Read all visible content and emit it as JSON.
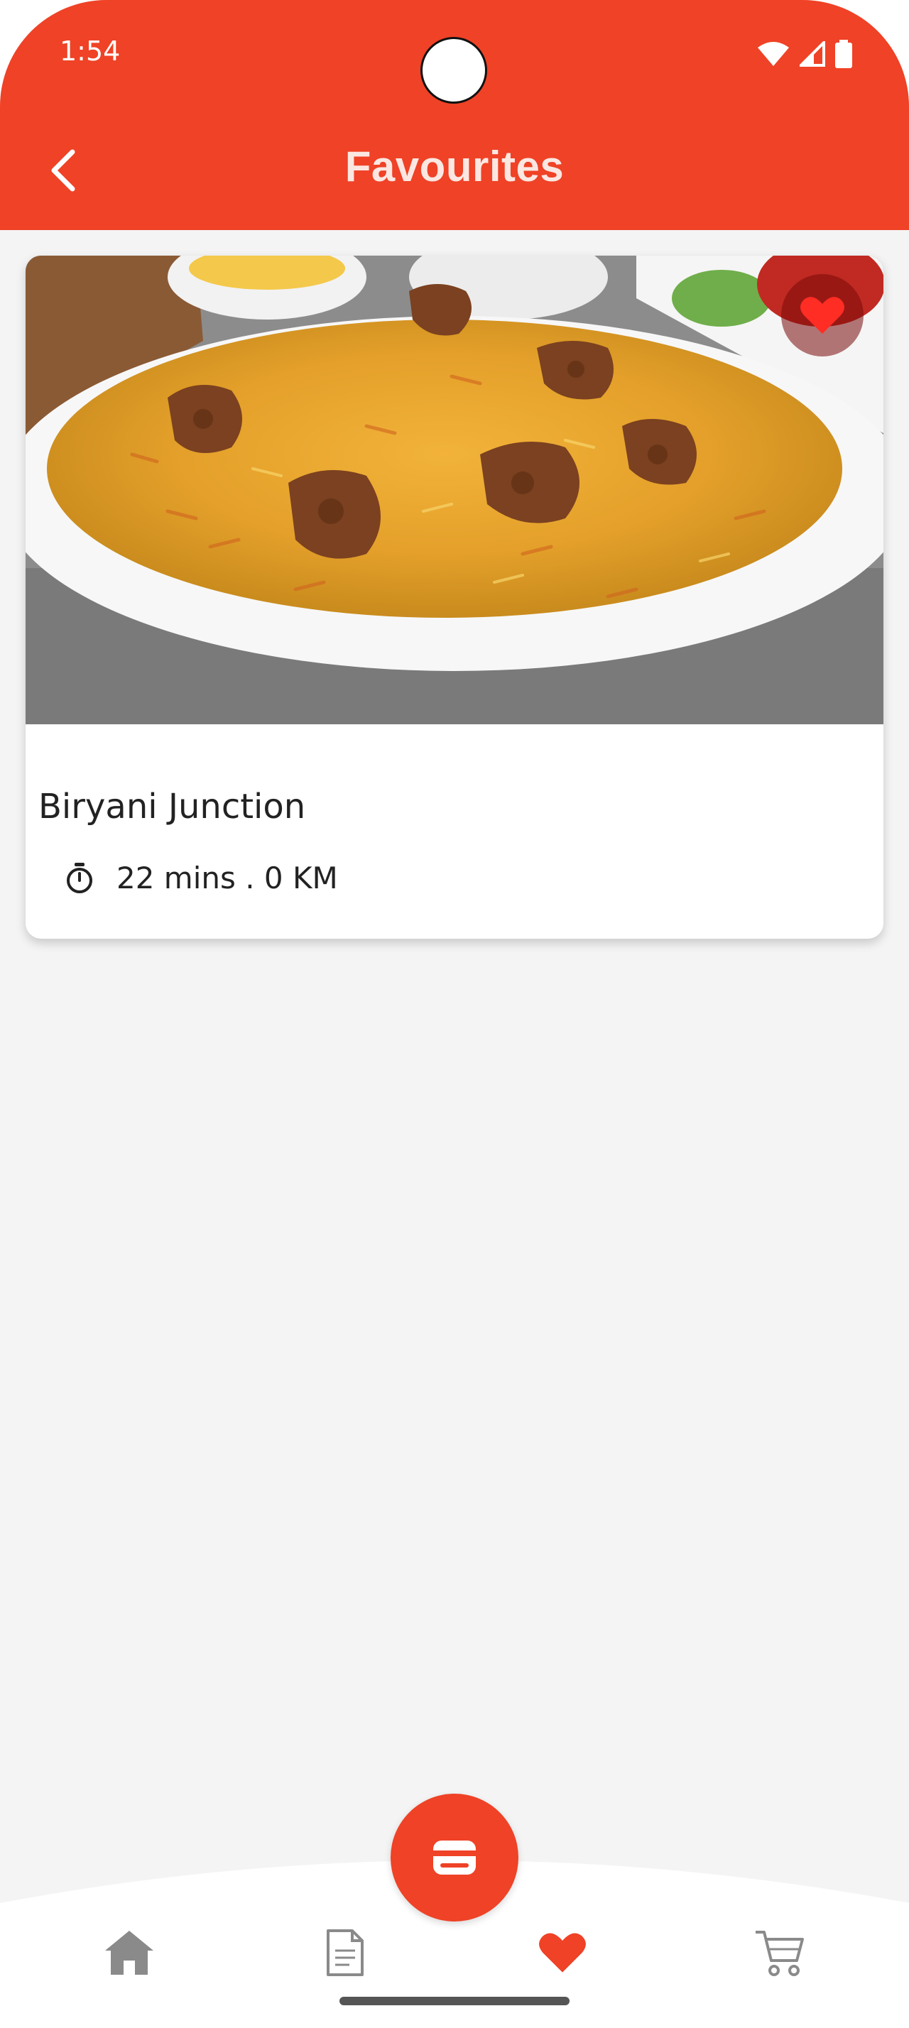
{
  "status_bar": {
    "time": "1:54",
    "icons": [
      "wifi-icon",
      "cell-signal-icon",
      "battery-icon"
    ]
  },
  "header": {
    "title": "Favourites",
    "back_icon": "chevron-left-icon"
  },
  "favourites": [
    {
      "name": "Biryani Junction",
      "meta": "22 mins . 0 KM",
      "image": "biryani-plate",
      "is_favourite": true
    }
  ],
  "bottom_nav": {
    "items": [
      {
        "icon": "home-icon",
        "active": false
      },
      {
        "icon": "orders-document-icon",
        "active": false
      },
      {
        "icon": "heart-icon",
        "active": true
      },
      {
        "icon": "cart-icon",
        "active": false
      }
    ],
    "center_button_icon": "wallet-icon"
  },
  "colors": {
    "primary": "#ef4226",
    "background": "#f4f4f4",
    "inactive_icon": "#8a8a8a"
  }
}
